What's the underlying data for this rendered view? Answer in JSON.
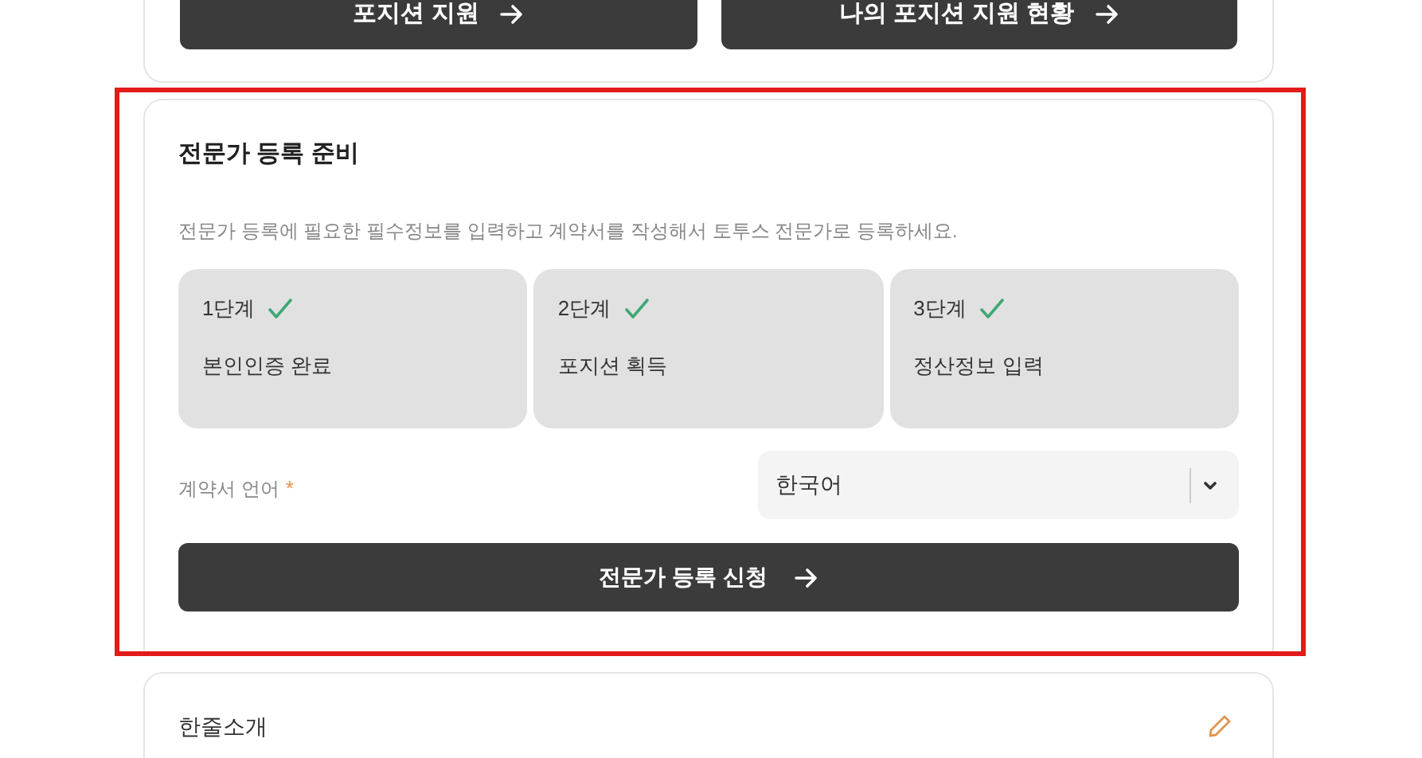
{
  "top_card": {
    "buttons": [
      {
        "label": "포지션 지원"
      },
      {
        "label": "나의 포지션 지원 현황"
      }
    ]
  },
  "registration_card": {
    "title": "전문가 등록 준비",
    "description": "전문가 등록에 필요한 필수정보를 입력하고 계약서를 작성해서 토투스 전문가로 등록하세요.",
    "steps": [
      {
        "label": "1단계",
        "done": true,
        "text": "본인인증 완료"
      },
      {
        "label": "2단계",
        "done": true,
        "text": "포지션 획득"
      },
      {
        "label": "3단계",
        "done": true,
        "text": "정산정보 입력"
      }
    ],
    "language_field": {
      "label": "계약서 언어",
      "required_mark": "*",
      "value": "한국어"
    },
    "submit_button": {
      "label": "전문가 등록 신청"
    }
  },
  "intro_card": {
    "title": "한줄소개"
  }
}
